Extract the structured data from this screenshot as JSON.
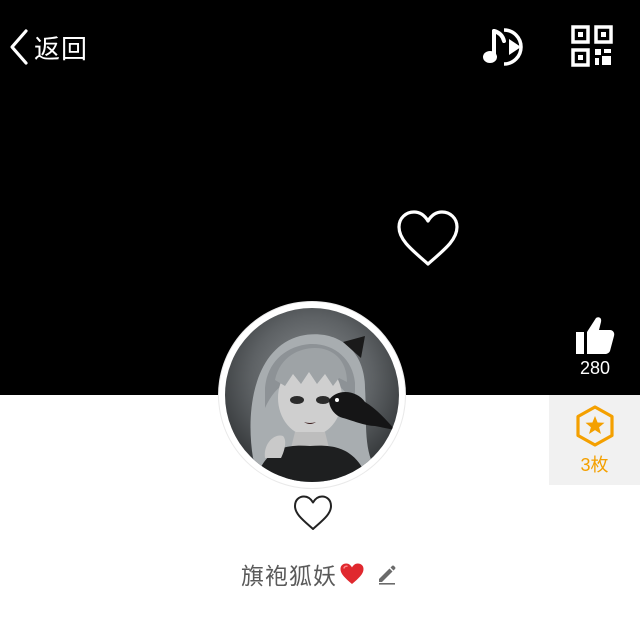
{
  "header": {
    "back_label": "返回",
    "back_icon": "chevron-left-icon",
    "music_icon": "music-play-icon",
    "qr_icon": "qr-code-icon"
  },
  "cover": {
    "background_color": "#000000",
    "decor_icon": "heart-outline-icon"
  },
  "profile": {
    "avatar_alt": "avatar",
    "follow_icon": "heart-outline-icon",
    "name": "旗袍狐妖",
    "name_emoji": "red-heart-icon",
    "edit_icon": "pencil-icon"
  },
  "side_actions": {
    "like": {
      "icon": "thumb-up-icon",
      "count": "280"
    },
    "badge": {
      "icon": "star-badge-icon",
      "count": "3枚",
      "color": "#f4a000",
      "panel_color": "#f1f1f1"
    }
  }
}
